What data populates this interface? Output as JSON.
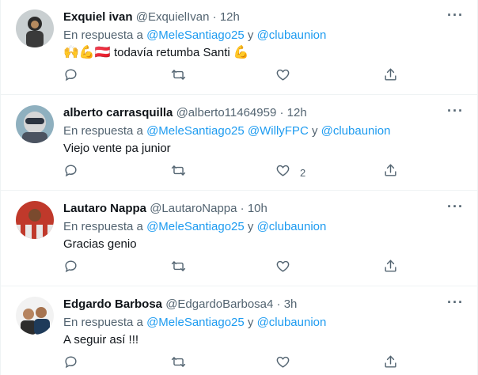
{
  "tweets": [
    {
      "name": "Exquiel ivan",
      "handle": "@ExquielIvan",
      "sep": "·",
      "time": "12h",
      "reply_prefix": "En respuesta a",
      "mention_1": "@MeleSantiago25",
      "joiner": "y",
      "mention_2": "@clubaunion",
      "emoji_prefix": "🙌💪🇦🇹",
      "text": "todavía retumba Santi",
      "emoji_suffix": "💪",
      "like_count": ""
    },
    {
      "name": "alberto carrasquilla",
      "handle": "@alberto11464959",
      "sep": "·",
      "time": "12h",
      "reply_prefix": "En respuesta a",
      "mention_1": "@MeleSantiago25",
      "mention_extra": "@WillyFPC",
      "joiner": "y",
      "mention_2": "@clubaunion",
      "text": "Viejo vente pa junior",
      "like_count": "2"
    },
    {
      "name": "Lautaro Nappa",
      "handle": "@LautaroNappa",
      "sep": "·",
      "time": "10h",
      "reply_prefix": "En respuesta a",
      "mention_1": "@MeleSantiago25",
      "joiner": "y",
      "mention_2": "@clubaunion",
      "text": "Gracias genio",
      "like_count": ""
    },
    {
      "name": "Edgardo Barbosa",
      "handle": "@EdgardoBarbosa4",
      "sep": "·",
      "time": "3h",
      "reply_prefix": "En respuesta a",
      "mention_1": "@MeleSantiago25",
      "joiner": "y",
      "mention_2": "@clubaunion",
      "text": "A seguir así !!!",
      "like_count": ""
    }
  ],
  "icons": {
    "reply": "reply-icon",
    "retweet": "retweet-icon",
    "like": "like-icon",
    "share": "share-icon",
    "more": "more-icon"
  },
  "colors": {
    "link": "#1d9bf0",
    "secondary": "#536471",
    "primary": "#0f1419",
    "border": "#eff3f4"
  }
}
